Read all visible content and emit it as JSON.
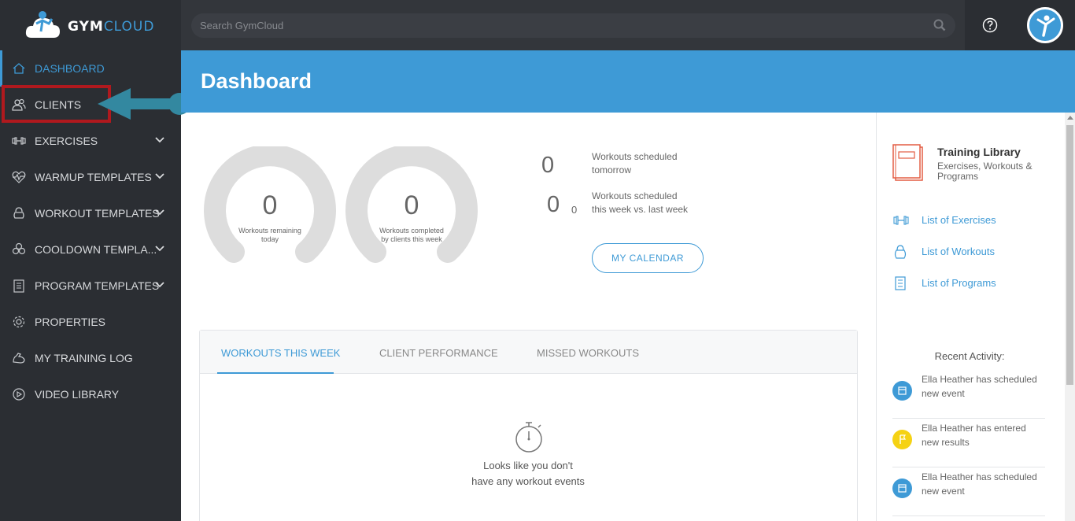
{
  "app": {
    "logo_text_a": "GYM",
    "logo_text_b": "CLOUD"
  },
  "search": {
    "placeholder": "Search GymCloud"
  },
  "sidebar": {
    "items": [
      {
        "label": "DASHBOARD",
        "icon": "home-icon",
        "active": true
      },
      {
        "label": "CLIENTS",
        "icon": "users-icon"
      },
      {
        "label": "EXERCISES",
        "icon": "dumbbell-icon",
        "expandable": true
      },
      {
        "label": "WARMUP TEMPLATES",
        "icon": "heartbeat-icon",
        "expandable": true
      },
      {
        "label": "WORKOUT TEMPLATES",
        "icon": "kettlebell-icon",
        "expandable": true
      },
      {
        "label": "COOLDOWN TEMPLA...",
        "icon": "fan-icon",
        "expandable": true
      },
      {
        "label": "PROGRAM TEMPLATES",
        "icon": "clipboard-icon",
        "expandable": true
      },
      {
        "label": "PROPERTIES",
        "icon": "gear-icon"
      },
      {
        "label": "MY TRAINING LOG",
        "icon": "muscle-icon"
      },
      {
        "label": "VIDEO LIBRARY",
        "icon": "play-icon"
      }
    ]
  },
  "header": {
    "title": "Dashboard"
  },
  "gauges": [
    {
      "value": "0",
      "caption_1": "Workouts remaining",
      "caption_2": "today"
    },
    {
      "value": "0",
      "caption_1": "Workouts completed",
      "caption_2": "by clients this week"
    }
  ],
  "stats": {
    "tomorrow_value": "0",
    "tomorrow_label_1": "Workouts scheduled",
    "tomorrow_label_2": "tomorrow",
    "week_value": "0",
    "last_week_value": "0",
    "week_label_1": "Workouts scheduled",
    "week_label_2": "this week vs. last week",
    "calendar_button": "MY CALENDAR"
  },
  "tabs": {
    "items": [
      "WORKOUTS THIS WEEK",
      "CLIENT PERFORMANCE",
      "MISSED WORKOUTS"
    ],
    "empty_line_1": "Looks like you don't",
    "empty_line_2": "have any workout events"
  },
  "library": {
    "title": "Training Library",
    "subtitle_1": "Exercises, Workouts &",
    "subtitle_2": "Programs",
    "links": [
      "List of Exercises",
      "List of Workouts",
      "List of Programs"
    ]
  },
  "recent": {
    "title": "Recent Activity:",
    "items": [
      {
        "line_1": "Ella Heather has scheduled",
        "line_2": "new event",
        "color": "#3e9ad6",
        "icon": "calendar-icon"
      },
      {
        "line_1": "Ella Heather has entered",
        "line_2": "new results",
        "color": "#f5d214",
        "icon": "flag-icon"
      },
      {
        "line_1": "Ella Heather has scheduled",
        "line_2": "new event",
        "color": "#3e9ad6",
        "icon": "calendar-icon"
      }
    ]
  },
  "colors": {
    "accent": "#3e9ad6",
    "dark": "#2b2e33",
    "highlight": "#b0191e",
    "arrow": "#3388a0"
  }
}
